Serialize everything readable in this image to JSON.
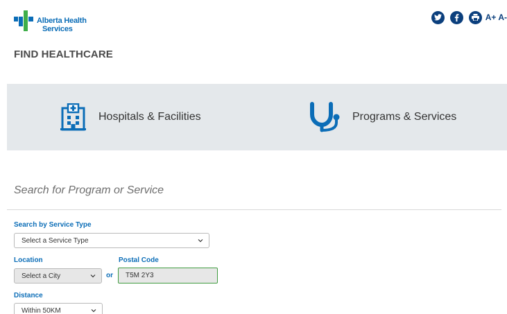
{
  "brand": {
    "name_line1": "Alberta Health",
    "name_line2": "Services",
    "colors": {
      "blue": "#0b6db7",
      "green": "#3fae49",
      "navy": "#0b3f7d"
    }
  },
  "header_tools": {
    "icons": [
      "twitter-icon",
      "facebook-icon",
      "print-icon"
    ],
    "font_increase": "A+",
    "font_decrease": "A-"
  },
  "page_title": "FIND HEALTHCARE",
  "categories": [
    {
      "label": "Hospitals & Facilities",
      "icon": "hospital-building-icon"
    },
    {
      "label": "Programs & Services",
      "icon": "stethoscope-icon"
    }
  ],
  "search": {
    "heading": "Search for Program or Service",
    "service_type": {
      "label": "Search by Service Type",
      "selected": "Select a Service Type"
    },
    "location": {
      "label": "Location",
      "selected": "Select a City"
    },
    "or_text": "or",
    "postal_code": {
      "label": "Postal Code",
      "value": "T5M 2Y3"
    },
    "distance": {
      "label": "Distance",
      "selected": "Within 50KM"
    }
  }
}
